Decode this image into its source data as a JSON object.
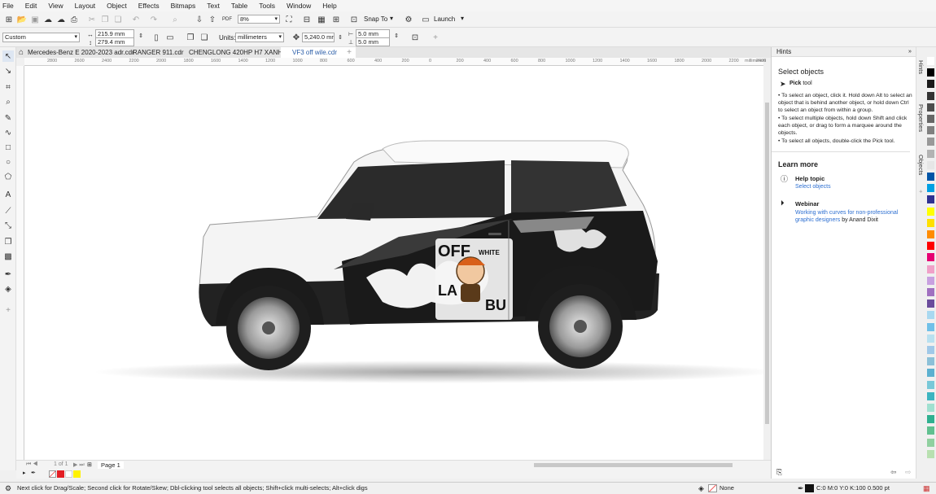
{
  "menu": [
    "File",
    "Edit",
    "View",
    "Layout",
    "Object",
    "Effects",
    "Bitmaps",
    "Text",
    "Table",
    "Tools",
    "Window",
    "Help"
  ],
  "toolbar": {
    "zoom": "8%",
    "snap_to": "Snap To",
    "launch": "Launch"
  },
  "property_bar": {
    "page_preset": "Custom",
    "width": "215.9 mm",
    "height": "279.4 mm",
    "units_label": "Units:",
    "units": "millimeters",
    "nudge": "5,240.0 mr",
    "dup_x": "5.0 mm",
    "dup_y": "5.0 mm"
  },
  "tabs": [
    {
      "label": "Mercedes-Benz E 2020-2023 adr.cdr",
      "active": false
    },
    {
      "label": "RANGER 911.cdr",
      "active": false
    },
    {
      "label": "CHENGLONG 420HP H7 XANH.cdr",
      "active": false
    },
    {
      "label": "VF3 off wile.cdr",
      "active": true
    }
  ],
  "ruler": {
    "h_ticks": [
      "2800",
      "2600",
      "2400",
      "2200",
      "2000",
      "1800",
      "1600",
      "1400",
      "1200",
      "1000",
      "800",
      "600",
      "400",
      "200",
      "0",
      "200",
      "400",
      "600",
      "800",
      "1000",
      "1200",
      "1400",
      "1600",
      "1800",
      "2000",
      "2200",
      "2400"
    ],
    "unit": "millimeters"
  },
  "canvas": {
    "logo_top": "OFF",
    "logo_sub": "WHITE",
    "logo_left": "LA",
    "logo_right": "BU"
  },
  "page_nav": {
    "counter": "1 of 1",
    "page": "Page 1"
  },
  "hints": {
    "header": "Hints",
    "title": "Select objects",
    "tool_name": "Pick",
    "tool_suffix": " tool",
    "bullets": [
      "• To select an object, click it. Hold down Alt to select an object that is behind another object, or hold down Ctrl to select an object from within a group.",
      "• To select multiple objects, hold down Shift and click each object, or drag to form a marquee around the objects.",
      "• To select all objects, double-click the Pick tool."
    ],
    "learn_more": "Learn more",
    "help_topic": "Help topic",
    "help_link": "Select objects",
    "webinar": "Webinar",
    "webinar_link": "Working with curves for non-professional graphic designers",
    "webinar_by": " by Anand Dixit"
  },
  "side_tabs": [
    "Hints",
    "Properties",
    "Objects"
  ],
  "palette": [
    "#ffffff",
    "#000000",
    "#1a1a1a",
    "#333333",
    "#4d4d4d",
    "#666666",
    "#808080",
    "#999999",
    "#b3b3b3",
    "#e6e6e6",
    "#0054a6",
    "#00a0e3",
    "#2e3192",
    "#ffff00",
    "#ffe000",
    "#ff8c00",
    "#ff0000",
    "#e60073",
    "#f0a0c8",
    "#c8a0e0",
    "#a070c0",
    "#6a4c9c",
    "#a8d8f0",
    "#70c0e8",
    "#b8e0f0",
    "#a0c8e8",
    "#8cc0d8",
    "#5cb0d0",
    "#78c8d8",
    "#3cb4c0",
    "#a0e0d0",
    "#30b090",
    "#60c090",
    "#90d0a0",
    "#b8e0b0"
  ],
  "status": {
    "hint": "Next click for Drag/Scale; Second click for Rotate/Skew; Dbl-clicking tool selects all objects; Shift+click multi-selects; Alt+click digs",
    "fill": "None",
    "outline": "C:0 M:0 Y:0 K:100  0.500 pt"
  }
}
